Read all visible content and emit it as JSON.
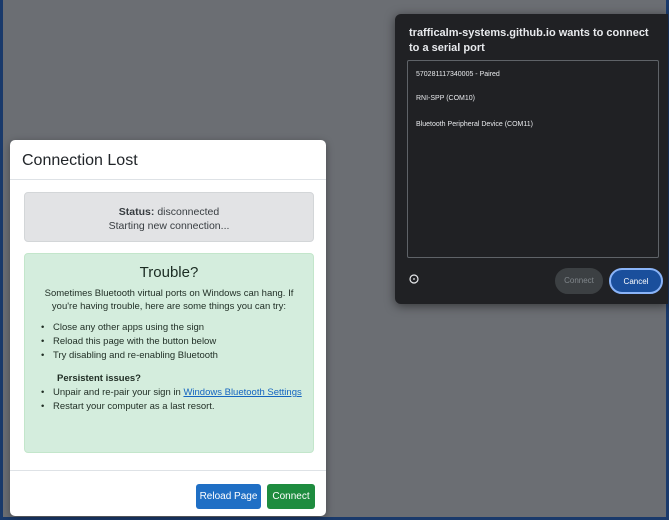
{
  "modal": {
    "title": "Connection Lost",
    "status": {
      "label": "Status:",
      "value": "disconnected",
      "detail": "Starting new connection..."
    },
    "trouble": {
      "title": "Trouble?",
      "intro": "Sometimes Bluetooth virtual ports on Windows can hang. If you're having trouble, here are some things you can try:",
      "tips": [
        "Close any other apps using the sign",
        "Reload this page with the button below",
        "Try disabling and re-enabling Bluetooth"
      ],
      "persistent_title": "Persistent issues?",
      "persistent_tip_prefix": "Unpair and re-pair your sign in ",
      "persistent_link": "Windows Bluetooth Settings",
      "persistent_tip2": "Restart your computer as a last resort."
    },
    "footer": {
      "reload_label": "Reload Page",
      "connect_label": "Connect"
    }
  },
  "chooser": {
    "title": "trafficalm-systems.github.io wants to connect to a serial port",
    "devices": [
      "570281117340005 - Paired",
      "RNI-SPP (COM10)",
      "Bluetooth Peripheral Device (COM11)"
    ],
    "help_icon": "help-icon",
    "connect_label": "Connect",
    "cancel_label": "Cancel"
  },
  "colors": {
    "backdrop": "#6b6e73",
    "trouble_bg": "#d4eddd",
    "status_bg": "#e2e3e5",
    "reload_button": "#1f6fc5",
    "connect_button": "#1e8c3f",
    "chooser_bg": "#202124",
    "cancel_button": "#1a4f9c"
  }
}
